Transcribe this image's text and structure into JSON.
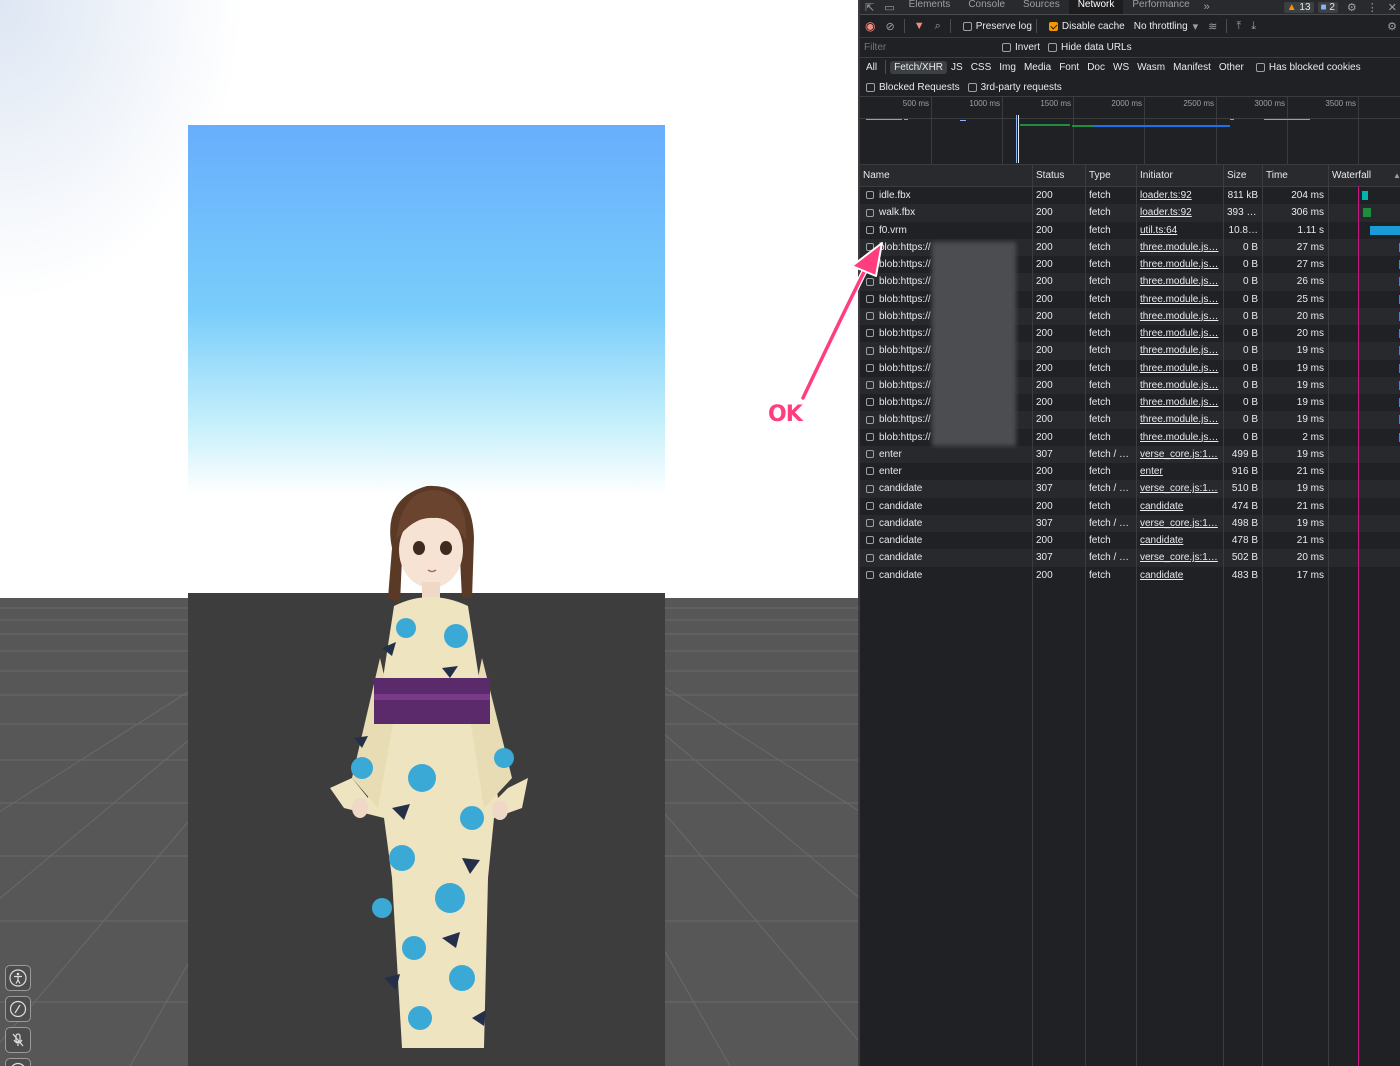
{
  "viewport": {
    "annotation": "OK",
    "icons": [
      "accessibility-icon",
      "mouse-icon",
      "mic-off-icon"
    ]
  },
  "devtools": {
    "tabs": [
      "Elements",
      "Console",
      "Sources",
      "Network",
      "Performance"
    ],
    "active_tab": "Network",
    "more_tabs": "»",
    "warnings": "13",
    "messages": "2",
    "toolbar": {
      "preserve_log": "Preserve log",
      "disable_cache": "Disable cache",
      "throttling": "No throttling"
    },
    "filter": {
      "placeholder": "Filter",
      "invert": "Invert",
      "hide_data_urls": "Hide data URLs"
    },
    "types": [
      "All",
      "Fetch/XHR",
      "JS",
      "CSS",
      "Img",
      "Media",
      "Font",
      "Doc",
      "WS",
      "Wasm",
      "Manifest",
      "Other"
    ],
    "active_type": "Fetch/XHR",
    "has_blocked_cookies": "Has blocked cookies",
    "blocked_requests": "Blocked Requests",
    "third_party": "3rd-party requests",
    "overview_ticks": [
      "500 ms",
      "1000 ms",
      "1500 ms",
      "2000 ms",
      "2500 ms",
      "3000 ms",
      "3500 ms"
    ],
    "columns": {
      "name": "Name",
      "status": "Status",
      "type": "Type",
      "initiator": "Initiator",
      "size": "Size",
      "time": "Time",
      "waterfall": "Waterfall"
    },
    "rows": [
      {
        "name": "idle.fbx",
        "status": "200",
        "type": "fetch",
        "initiator": "loader.ts:92",
        "size": "811 kB",
        "time": "204 ms"
      },
      {
        "name": "walk.fbx",
        "status": "200",
        "type": "fetch",
        "initiator": "loader.ts:92",
        "size": "393 kB",
        "time": "306 ms"
      },
      {
        "name": "f0.vrm",
        "status": "200",
        "type": "fetch",
        "initiator": "util.ts:64",
        "size": "10.8…",
        "time": "1.11 s"
      },
      {
        "name": "blob:https://",
        "status": "200",
        "type": "fetch",
        "initiator": "three.module.js…",
        "size": "0 B",
        "time": "27 ms"
      },
      {
        "name": "blob:https://",
        "status": "200",
        "type": "fetch",
        "initiator": "three.module.js…",
        "size": "0 B",
        "time": "27 ms"
      },
      {
        "name": "blob:https://",
        "status": "200",
        "type": "fetch",
        "initiator": "three.module.js…",
        "size": "0 B",
        "time": "26 ms"
      },
      {
        "name": "blob:https://",
        "status": "200",
        "type": "fetch",
        "initiator": "three.module.js…",
        "size": "0 B",
        "time": "25 ms"
      },
      {
        "name": "blob:https://",
        "status": "200",
        "type": "fetch",
        "initiator": "three.module.js…",
        "size": "0 B",
        "time": "20 ms"
      },
      {
        "name": "blob:https://",
        "status": "200",
        "type": "fetch",
        "initiator": "three.module.js…",
        "size": "0 B",
        "time": "20 ms"
      },
      {
        "name": "blob:https://",
        "status": "200",
        "type": "fetch",
        "initiator": "three.module.js…",
        "size": "0 B",
        "time": "19 ms"
      },
      {
        "name": "blob:https://",
        "status": "200",
        "type": "fetch",
        "initiator": "three.module.js…",
        "size": "0 B",
        "time": "19 ms"
      },
      {
        "name": "blob:https://",
        "status": "200",
        "type": "fetch",
        "initiator": "three.module.js…",
        "size": "0 B",
        "time": "19 ms"
      },
      {
        "name": "blob:https://",
        "status": "200",
        "type": "fetch",
        "initiator": "three.module.js…",
        "size": "0 B",
        "time": "19 ms"
      },
      {
        "name": "blob:https://",
        "status": "200",
        "type": "fetch",
        "initiator": "three.module.js…",
        "size": "0 B",
        "time": "19 ms"
      },
      {
        "name": "blob:https://",
        "status": "200",
        "type": "fetch",
        "initiator": "three.module.js…",
        "size": "0 B",
        "time": "2 ms"
      },
      {
        "name": "enter",
        "status": "307",
        "type": "fetch / …",
        "initiator": "verse_core.js:1…",
        "size": "499 B",
        "time": "19 ms"
      },
      {
        "name": "enter",
        "status": "200",
        "type": "fetch",
        "initiator": "enter",
        "size": "916 B",
        "time": "21 ms"
      },
      {
        "name": "candidate",
        "status": "307",
        "type": "fetch / …",
        "initiator": "verse_core.js:1…",
        "size": "510 B",
        "time": "19 ms"
      },
      {
        "name": "candidate",
        "status": "200",
        "type": "fetch",
        "initiator": "candidate",
        "size": "474 B",
        "time": "21 ms"
      },
      {
        "name": "candidate",
        "status": "307",
        "type": "fetch / …",
        "initiator": "verse_core.js:1…",
        "size": "498 B",
        "time": "19 ms"
      },
      {
        "name": "candidate",
        "status": "200",
        "type": "fetch",
        "initiator": "candidate",
        "size": "478 B",
        "time": "21 ms"
      },
      {
        "name": "candidate",
        "status": "307",
        "type": "fetch / …",
        "initiator": "verse_core.js:1…",
        "size": "502 B",
        "time": "20 ms"
      },
      {
        "name": "candidate",
        "status": "200",
        "type": "fetch",
        "initiator": "candidate",
        "size": "483 B",
        "time": "17 ms"
      }
    ]
  }
}
